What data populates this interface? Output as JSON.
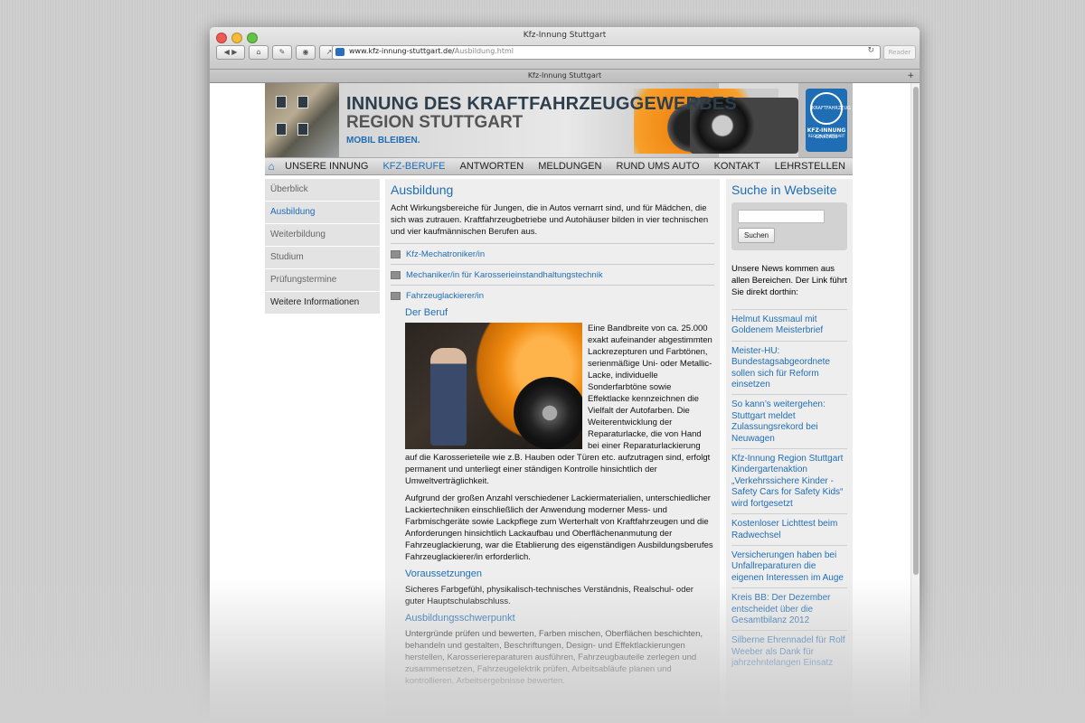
{
  "browser": {
    "window_title": "Kfz-Innung Stuttgart",
    "tab_title": "Kfz-Innung Stuttgart",
    "url_host": "www.kfz-innung-stuttgart.de/",
    "url_path": "Ausbildung.html",
    "reader_label": "Reader"
  },
  "banner": {
    "title": "INNUNG DES KRAFTFAHRZEUGGEWERBES",
    "subtitle": "REGION STUTTGART",
    "slogan": "MOBIL BLEIBEN.",
    "logo_ring": "KRAFTFAHRZEUG GEWERBE",
    "logo_line1": "KFZ-INNUNG",
    "logo_line2": "REGION STUTTGART"
  },
  "topnav": [
    "UNSERE INNUNG",
    "KFZ-BERUFE",
    "ANTWORTEN",
    "MELDUNGEN",
    "RUND UMS AUTO",
    "KONTAKT",
    "LEHRSTELLEN"
  ],
  "leftnav": [
    "Überblick",
    "Ausbildung",
    "Weiterbildung",
    "Studium",
    "Prüfungstermine",
    "Weitere Informationen"
  ],
  "main": {
    "heading": "Ausbildung",
    "intro": "Acht Wirkungsbereiche für Jungen, die in Autos vernarrt sind, und für Mädchen, die sich was zutrauen. Kraftfahrzeugbetriebe und Autohäuser bilden in vier technischen und vier kaufmännischen Berufen aus.",
    "accordion": [
      "Kfz-Mechatroniker/in",
      "Mechaniker/in für Karosserieinstandhaltungstechnik",
      "Fahrzeuglackierer/in"
    ],
    "beruf_heading": "Der Beruf",
    "beruf_text1": "Eine Bandbreite von ca. 25.000 exakt aufeinander abgestimmten Lackrezepturen und Farbtönen, serienmäßige Uni- oder Metallic-Lacke, individuelle Sonderfarbtöne sowie Effektlacke kennzeichnen die Vielfalt der Autofarben. Die Weiterentwicklung der Reparaturlacke, die von Hand bei einer Reparaturlackierung auf die Karosserieteile wie z.B. Hauben oder Türen etc. aufzutragen sind, erfolgt permanent und unterliegt einer ständigen Kontrolle hinsichtlich der Umweltverträglichkeit.",
    "beruf_text2": "Aufgrund der großen Anzahl verschiedener Lackiermaterialien, unterschiedlicher Lackiertechniken einschließlich der Anwendung moderner Mess- und Farbmischgeräte sowie Lackpflege zum Werterhalt von Kraftfahrzeugen und die Anforderungen hinsichtlich Lackaufbau und Oberflächenanmutung der Fahrzeuglackierung, war die Etablierung des eigenständigen Ausbildungsberufes Fahrzeuglackierer/in erforderlich.",
    "voraus_heading": "Voraussetzungen",
    "voraus_text": "Sicheres Farbgefühl, physikalisch-technisches Verständnis, Realschul- oder guter Hauptschulabschluss.",
    "schwer_heading": "Ausbildungsschwerpunkt",
    "schwer_text": "Untergründe prüfen und bewerten, Farben mischen, Oberflächen beschichten, behandeln und gestalten, Beschriftungen, Design- und Effektlackierungen herstellen, Karosseriereparaturen ausführen, Fahrzeugbauteile zerlegen und zusammensetzen, Fahrzeugelektrik prüfen, Arbeitsabläufe planen und kontrollieren, Arbeitsergebnisse bewerten."
  },
  "sidebar": {
    "heading": "Suche in Webseite",
    "search_button": "Suchen",
    "news_intro": "Unsere News kommen aus allen Bereichen. Der Link führt Sie direkt dorthin:",
    "news": [
      "Helmut Kussmaul mit Goldenem Meisterbrief",
      "Meister-HU: Bundestagsabgeordnete sollen sich für Reform einsetzen",
      "So kann’s weitergehen: Stuttgart meldet Zulassungsrekord bei Neuwagen",
      "Kfz-Innung Region Stuttgart Kindergartenaktion „Verkehrssichere Kinder - Safety Cars for Safety Kids“ wird fortgesetzt",
      "Kostenloser Lichttest beim Radwechsel",
      "Versicherungen haben bei Unfallreparaturen die eigenen Interessen im Auge",
      "Kreis BB: Der Dezember entscheidet über die Gesamtbilanz 2012",
      "Silberne Ehrennadel für Rolf Weeber als Dank für jahrzehntelangen Einsatz"
    ]
  }
}
